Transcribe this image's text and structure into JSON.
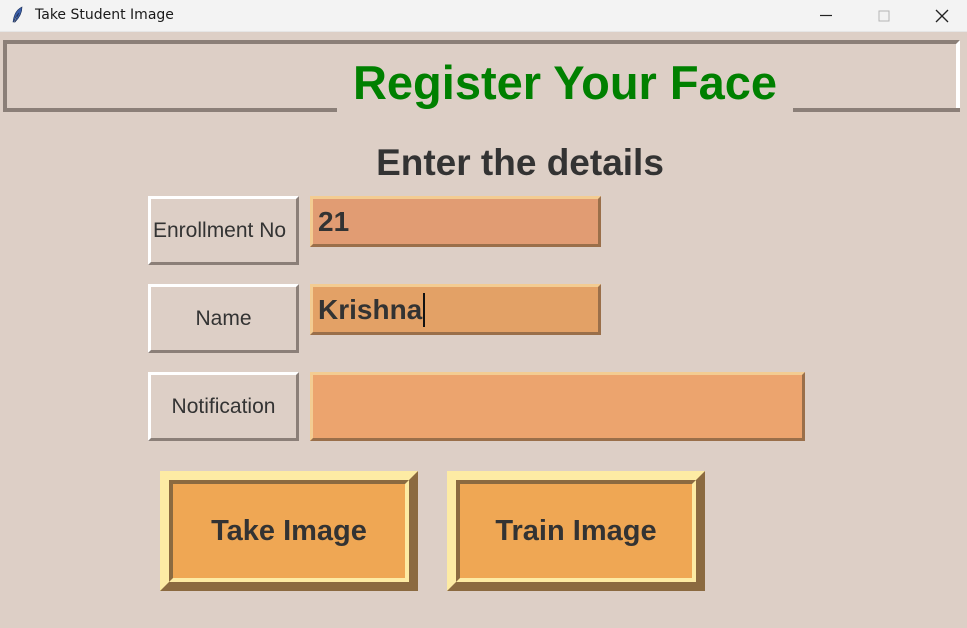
{
  "window": {
    "title": "Take Student Image",
    "app_icon": "feather-icon",
    "controls": [
      "minimize-icon",
      "maximize-icon",
      "close-icon"
    ]
  },
  "header": {
    "title": "Register Your Face",
    "title_color": "#008000"
  },
  "form": {
    "heading": "Enter the details",
    "fields": [
      {
        "label": "Enrollment No",
        "value": "21"
      },
      {
        "label": "Name",
        "value": "Krishna"
      },
      {
        "label": "Notification",
        "value": ""
      }
    ]
  },
  "buttons": {
    "take_image": "Take Image",
    "train_image": "Train Image"
  },
  "colors": {
    "background": "#ddcfc6",
    "button_bg": "#efa754",
    "enroll_entry_bg": "#e19c73",
    "name_entry_bg": "#e3a166",
    "notification_bg": "#eca46e"
  }
}
